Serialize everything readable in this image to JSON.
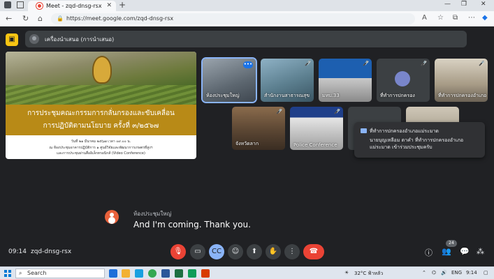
{
  "browser": {
    "tab_title": "Meet - zqd-dnsg-rsx",
    "new_tab_label": "+",
    "url": "https://meet.google.com/zqd-dnsg-rsx"
  },
  "meet": {
    "presenter_label": "เครื่องนำเสนอ (การนำเสนอ)",
    "slide": {
      "title_line1": "การประชุมคณะกรรมการกลั่นกรองและขับเคลื่อน",
      "title_line2": "การปฏิบัติตามนโยบาย ครั้งที่ ๓/๒๕๖๗",
      "detail_line1": "วันที่ ๒๑ มีนาคม ๒๕๖๗ เวลา ๐๙.๐๐ น.",
      "detail_line2": "ณ ห้องประชุมอาคารปฏิบัติการ ๑ ศูนย์วิจัยและพัฒนาการเกษตรที่สูงฯ",
      "detail_line3": "และการประชุมผ่านสื่ออิเล็กทรอนิกส์ (Video Conference)"
    },
    "tiles": [
      {
        "label": "ห้องประชุมใหญ่",
        "more": "•••"
      },
      {
        "label": "สำนักงานสาธารณสุข",
        "mic": "🎤̸"
      },
      {
        "label": "มทบ.33",
        "mic": "🎤̸"
      },
      {
        "label": "ที่ทำการปกครอง",
        "mic": "🎤̸"
      },
      {
        "label": "ที่ทำการปกครองอำเภอ",
        "mic": "🎤̸"
      },
      {
        "label": "จังหวัดลาก",
        "mic": "🎤̸"
      },
      {
        "label": "Police Conference",
        "mic": "🎤̸"
      }
    ],
    "chat_popup": {
      "sender": "ที่ทำการปกครองอำเภอแม่ระมาด",
      "message": "นายบุญเหลือม ตาคำ ที่ทำการปกครองอำเภอแม่ระมาด เข้าร่วมประชุมครับ"
    },
    "caption": {
      "speaker": "ห้องประชุมใหญ่",
      "text": "And I'm coming. Thank you."
    },
    "bottom": {
      "time": "09:14",
      "meeting_code": "zqd-dnsg-rsx",
      "participants_count": "24"
    }
  },
  "taskbar": {
    "search_placeholder": "Search",
    "weather": "32°C ฟ้าหลัว",
    "language": "ENG",
    "time": "9:14"
  },
  "colors": {
    "meet_bg": "#202124",
    "end_call": "#ea4335",
    "accent_blue": "#8ab4f8",
    "slide_band": "#b88a17"
  }
}
